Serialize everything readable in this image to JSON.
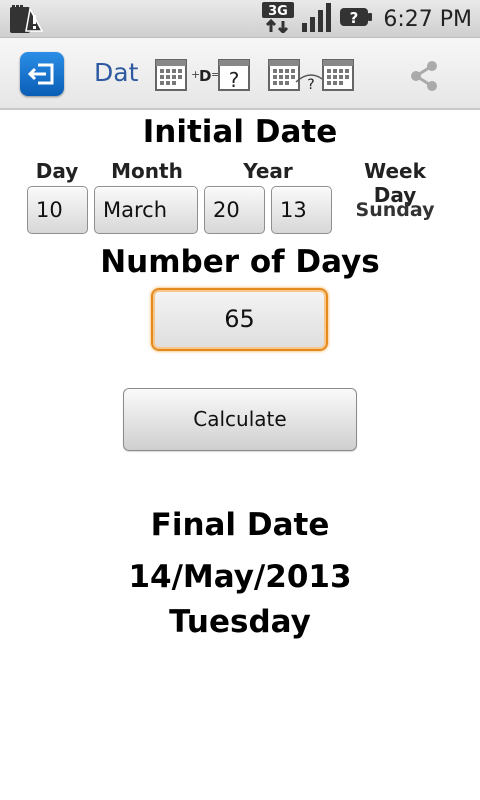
{
  "status_bar": {
    "network": "3G",
    "time": "6:27 PM"
  },
  "action_bar": {
    "title": "Dat",
    "tabs": [
      {
        "name": "add-days-tab"
      },
      {
        "name": "days-between-tab"
      }
    ],
    "add_tab_glyph": "D",
    "question_mark": "?"
  },
  "initial_date": {
    "heading": "Initial Date",
    "labels": {
      "day": "Day",
      "month": "Month",
      "year": "Year",
      "weekday": "Week Day"
    },
    "day": "10",
    "month": "March",
    "year_century": "20",
    "year_two_digit": "13",
    "weekday": "Sunday"
  },
  "number_of_days": {
    "heading": "Number of Days",
    "value": "65"
  },
  "calculate_label": "Calculate",
  "final": {
    "heading": "Final Date",
    "date": "14/May/2013",
    "weekday": "Tuesday"
  },
  "colors": {
    "accent": "#e58a1f",
    "title_blue": "#2d5aa0",
    "app_icon": "#0a5db5"
  }
}
